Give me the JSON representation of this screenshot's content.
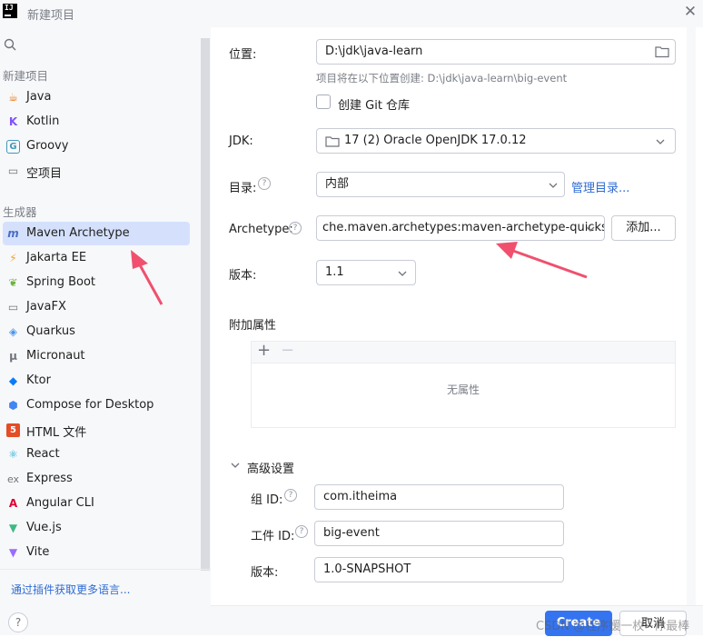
{
  "window": {
    "title": "新建项目",
    "close_icon": "close-icon"
  },
  "search": {
    "placeholder": ""
  },
  "sidebar": {
    "section_new_project": "新建项目",
    "new_project_items": [
      {
        "label": "Java",
        "icon": "java-icon",
        "color": "#e76f00"
      },
      {
        "label": "Kotlin",
        "icon": "kotlin-icon",
        "color": "#7f52ff"
      },
      {
        "label": "Groovy",
        "icon": "groovy-icon",
        "color": "#4298b8"
      },
      {
        "label": "空项目",
        "icon": "empty-project-icon",
        "color": "#6f737a"
      }
    ],
    "section_generators": "生成器",
    "generator_items": [
      {
        "label": "Maven Archetype",
        "icon": "maven-icon",
        "color": "#4a6fc0",
        "selected": true
      },
      {
        "label": "Jakarta EE",
        "icon": "jakarta-ee-icon",
        "color": "#f0a030"
      },
      {
        "label": "Spring Boot",
        "icon": "spring-boot-icon",
        "color": "#6db33f"
      },
      {
        "label": "JavaFX",
        "icon": "javafx-icon",
        "color": "#6f737a"
      },
      {
        "label": "Quarkus",
        "icon": "quarkus-icon",
        "color": "#4695eb"
      },
      {
        "label": "Micronaut",
        "icon": "micronaut-icon",
        "color": "#6f737a"
      },
      {
        "label": "Ktor",
        "icon": "ktor-icon",
        "color": "#087cfa"
      },
      {
        "label": "Compose for Desktop",
        "icon": "compose-icon",
        "color": "#4285f4"
      },
      {
        "label": "HTML 文件",
        "icon": "html-icon",
        "color": "#e44d26"
      },
      {
        "label": "React",
        "icon": "react-icon",
        "color": "#1ba9d6"
      },
      {
        "label": "Express",
        "icon": "express-icon",
        "color": "#6f737a"
      },
      {
        "label": "Angular CLI",
        "icon": "angular-icon",
        "color": "#dd0031"
      },
      {
        "label": "Vue.js",
        "icon": "vue-icon",
        "color": "#41b883"
      },
      {
        "label": "Vite",
        "icon": "vite-icon",
        "color": "#9b6bff"
      }
    ],
    "plugins_link": "通过插件获取更多语言..."
  },
  "form": {
    "location_label": "位置:",
    "location_value": "D:\\jdk\\java-learn",
    "location_hint": "项目将在以下位置创建: D:\\jdk\\java-learn\\big-event",
    "git_checkbox_label": "创建 Git 仓库",
    "git_checked": false,
    "jdk_label": "JDK:",
    "jdk_value": "17 (2) Oracle OpenJDK 17.0.12",
    "catalog_label": "目录:",
    "catalog_value": "内部",
    "manage_catalogs_link": "管理目录...",
    "archetype_label": "Archetype:",
    "archetype_value": "che.maven.archetypes:maven-archetype-quicksta",
    "add_button": "添加...",
    "version_label": "版本:",
    "version_value": "1.1",
    "additional_props_label": "附加属性",
    "no_props_text": "无属性",
    "advanced_label": "高级设置",
    "group_id_label": "组 ID:",
    "group_id_value": "com.itheima",
    "artifact_id_label": "工件 ID:",
    "artifact_id_value": "big-event",
    "artifact_version_label": "版本:",
    "artifact_version_value": "1.0-SNAPSHOT"
  },
  "footer": {
    "create_button": "Create",
    "cancel_button": "取消",
    "help": "?",
    "watermark": "CSDN @程序媛一枚~你最棒"
  },
  "colors": {
    "accent": "#3574f0",
    "selection": "#d5e1fc",
    "annotation_arrow": "#f0506e"
  }
}
